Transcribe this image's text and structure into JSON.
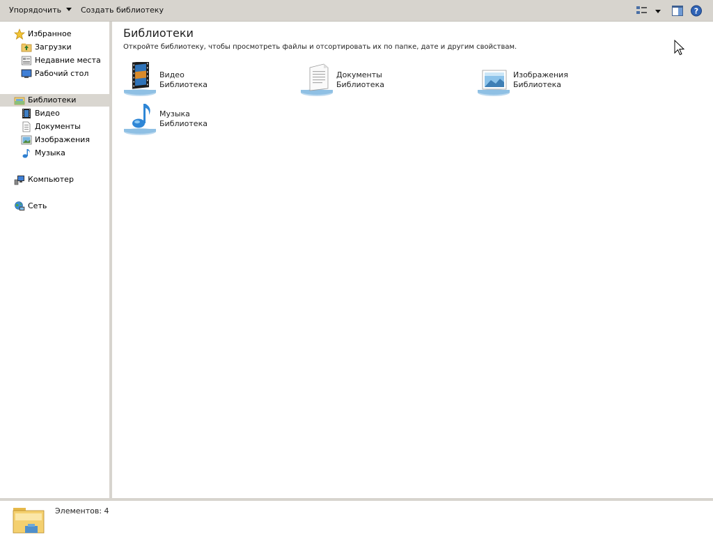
{
  "toolbar": {
    "organize_label": "Упорядочить",
    "new_library_label": "Создать библиотеку"
  },
  "nav": {
    "favorites": {
      "label": "Избранное",
      "items": [
        {
          "label": "Загрузки",
          "icon": "downloads-icon"
        },
        {
          "label": "Недавние места",
          "icon": "recent-places-icon"
        },
        {
          "label": "Рабочий стол",
          "icon": "desktop-icon"
        }
      ]
    },
    "libraries": {
      "label": "Библиотеки",
      "items": [
        {
          "label": "Видео",
          "icon": "video-icon"
        },
        {
          "label": "Документы",
          "icon": "documents-icon"
        },
        {
          "label": "Изображения",
          "icon": "pictures-icon"
        },
        {
          "label": "Музыка",
          "icon": "music-icon"
        }
      ]
    },
    "computer_label": "Компьютер",
    "network_label": "Сеть"
  },
  "main": {
    "title": "Библиотеки",
    "description": "Откройте библиотеку, чтобы просмотреть файлы и отсортировать их по папке, дате и другим свойствам.",
    "libraries": [
      {
        "name": "Видео",
        "type": "Библиотека",
        "icon": "video-library-icon"
      },
      {
        "name": "Документы",
        "type": "Библиотека",
        "icon": "documents-library-icon"
      },
      {
        "name": "Изображения",
        "type": "Библиотека",
        "icon": "pictures-library-icon"
      },
      {
        "name": "Музыка",
        "type": "Библиотека",
        "icon": "music-library-icon"
      }
    ]
  },
  "status": {
    "items_count": "Элементов: 4"
  },
  "colors": {
    "toolbar_bg": "#d7d4ce",
    "selected_bg": "#d9d6d0",
    "accent_blue": "#2f6fb5"
  }
}
